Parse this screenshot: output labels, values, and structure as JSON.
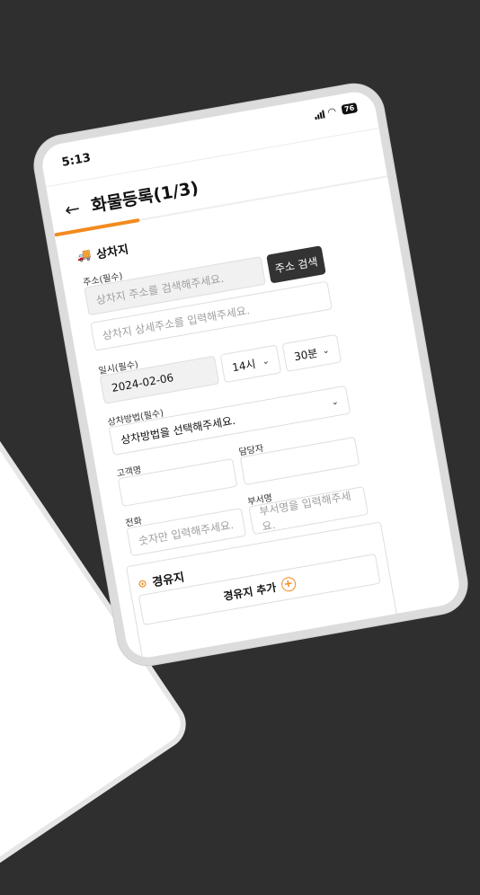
{
  "status": {
    "time": "5:13",
    "battery": "76"
  },
  "header": {
    "title": "화물등록(1/3)"
  },
  "loading": {
    "section_title": "상차지",
    "address_label": "주소(필수)",
    "address_placeholder": "상차지 주소를 검색해주세요.",
    "search_button": "주소 검색",
    "detail_placeholder": "상차지 상세주소를 입력해주세요.",
    "datetime_label": "일시(필수)",
    "date_value": "2024-02-06",
    "hour_value": "14시",
    "minute_value": "30분",
    "method_label": "상차방법(필수)",
    "method_value": "상차방법을 선택해주세요.",
    "customer_label": "고객명",
    "manager_label": "담당자",
    "dept_label": "부서명",
    "dept_placeholder": "부서명을 입력해주세요.",
    "phone_label": "전화",
    "phone_placeholder": "숫자만 입력해주세요."
  },
  "waypoint": {
    "section_title": "경유지",
    "add_button": "경유지 추가"
  },
  "colors": {
    "accent": "#f28a1e",
    "dark_button": "#333333",
    "background": "#2f2f2f"
  }
}
